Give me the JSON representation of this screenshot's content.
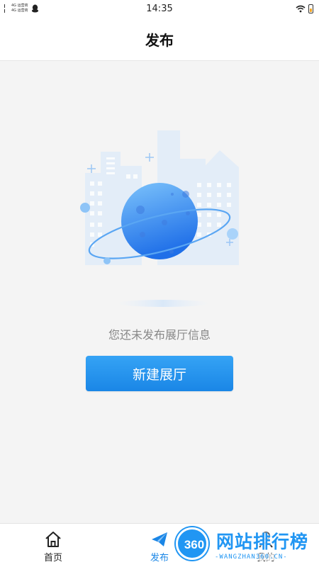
{
  "status_bar": {
    "network_line1": "4G 运营商",
    "network_line2": "4G 运营商",
    "time": "14:35"
  },
  "header": {
    "title": "发布"
  },
  "main": {
    "empty_message": "您还未发布展厅信息",
    "create_button_label": "新建展厅",
    "illustration_icon": "planet-city-icon"
  },
  "bottom_nav": {
    "items": [
      {
        "label": "首页",
        "icon": "home-icon",
        "active": false
      },
      {
        "label": "发布",
        "icon": "paper-plane-icon",
        "active": true
      },
      {
        "label": "我的",
        "icon": "person-icon",
        "active": false
      }
    ]
  },
  "watermark": {
    "badge": "360",
    "title": "网站排行榜",
    "subtitle": "-WANGZHAN360.CN-"
  },
  "colors": {
    "accent": "#1a86e6",
    "button_top": "#35a3f5",
    "planet": "#2f7ff0",
    "background": "#f4f4f4"
  }
}
